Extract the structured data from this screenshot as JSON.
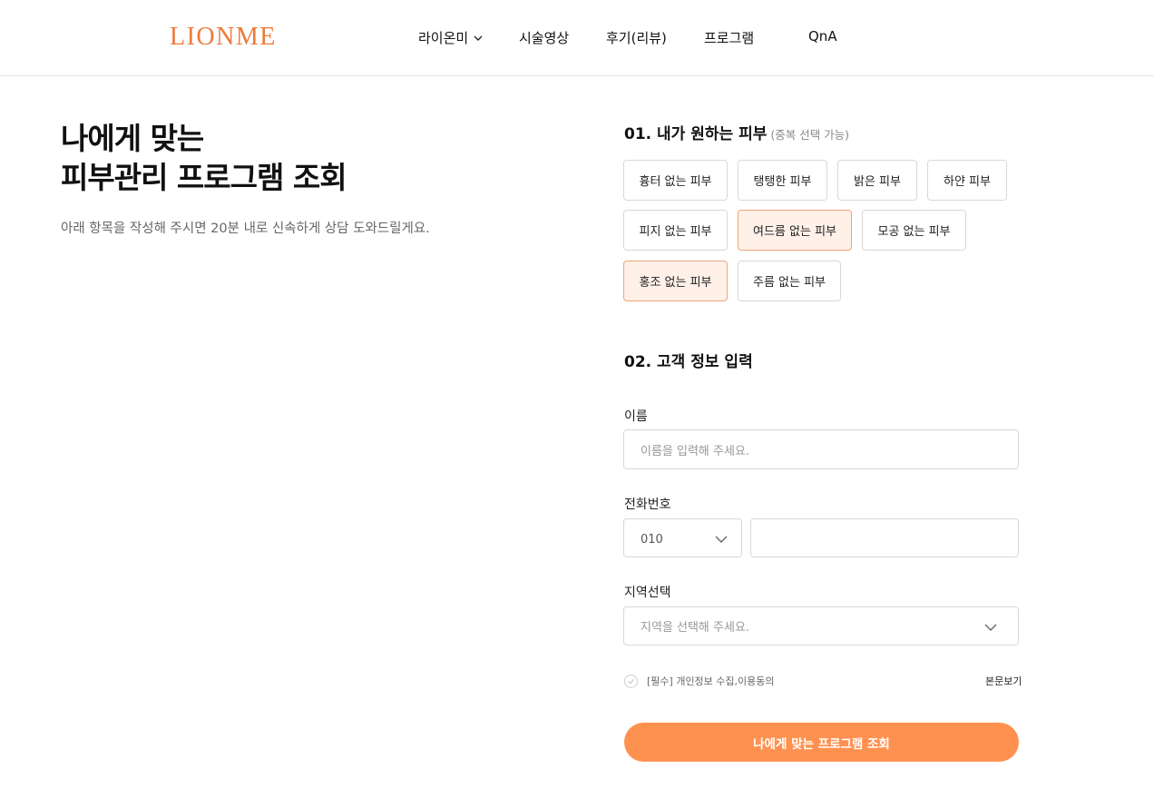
{
  "header": {
    "logo": "LIONME",
    "nav": [
      {
        "label": "라이온미",
        "has_dropdown": true
      },
      {
        "label": "시술영상"
      },
      {
        "label": "후기(리뷰)"
      },
      {
        "label": "프로그램"
      },
      {
        "label": "QnA"
      }
    ]
  },
  "hero": {
    "title_line1": "나에게 맞는",
    "title_line2": "피부관리 프로그램 조회",
    "subtitle": "아래 항목을 작성해 주시면 20분 내로 신속하게 상담 도와드릴게요."
  },
  "section1": {
    "title": "01. 내가 원하는 피부",
    "note": "(중복 선택 가능)",
    "options": [
      {
        "label": "흉터 없는 피부",
        "selected": false
      },
      {
        "label": "탱탱한 피부",
        "selected": false
      },
      {
        "label": "밝은 피부",
        "selected": false
      },
      {
        "label": "하얀 피부",
        "selected": false
      },
      {
        "label": "피지 없는 피부",
        "selected": false
      },
      {
        "label": "여드름 없는 피부",
        "selected": true
      },
      {
        "label": "모공 없는 피부",
        "selected": false
      },
      {
        "label": "홍조 없는 피부",
        "selected": true
      },
      {
        "label": "주름 없는 피부",
        "selected": false
      }
    ]
  },
  "section2": {
    "title": "02. 고객 정보 입력",
    "name_label": "이름",
    "name_placeholder": "이름을 입력해 주세요.",
    "phone_label": "전화번호",
    "phone_prefix": "010",
    "phone_value": "",
    "region_label": "지역선택",
    "region_placeholder": "지역을 선택해 주세요."
  },
  "agreement": {
    "text": "[필수] 개인정보 수집,이용동의",
    "view_link": "본문보기"
  },
  "submit_label": "나에게 맞는 프로그램 조회",
  "colors": {
    "brand": "#ec7a3c",
    "button": "#ff9150",
    "chip_selected_bg": "#fff0e8",
    "chip_selected_border": "#f0a57d"
  }
}
